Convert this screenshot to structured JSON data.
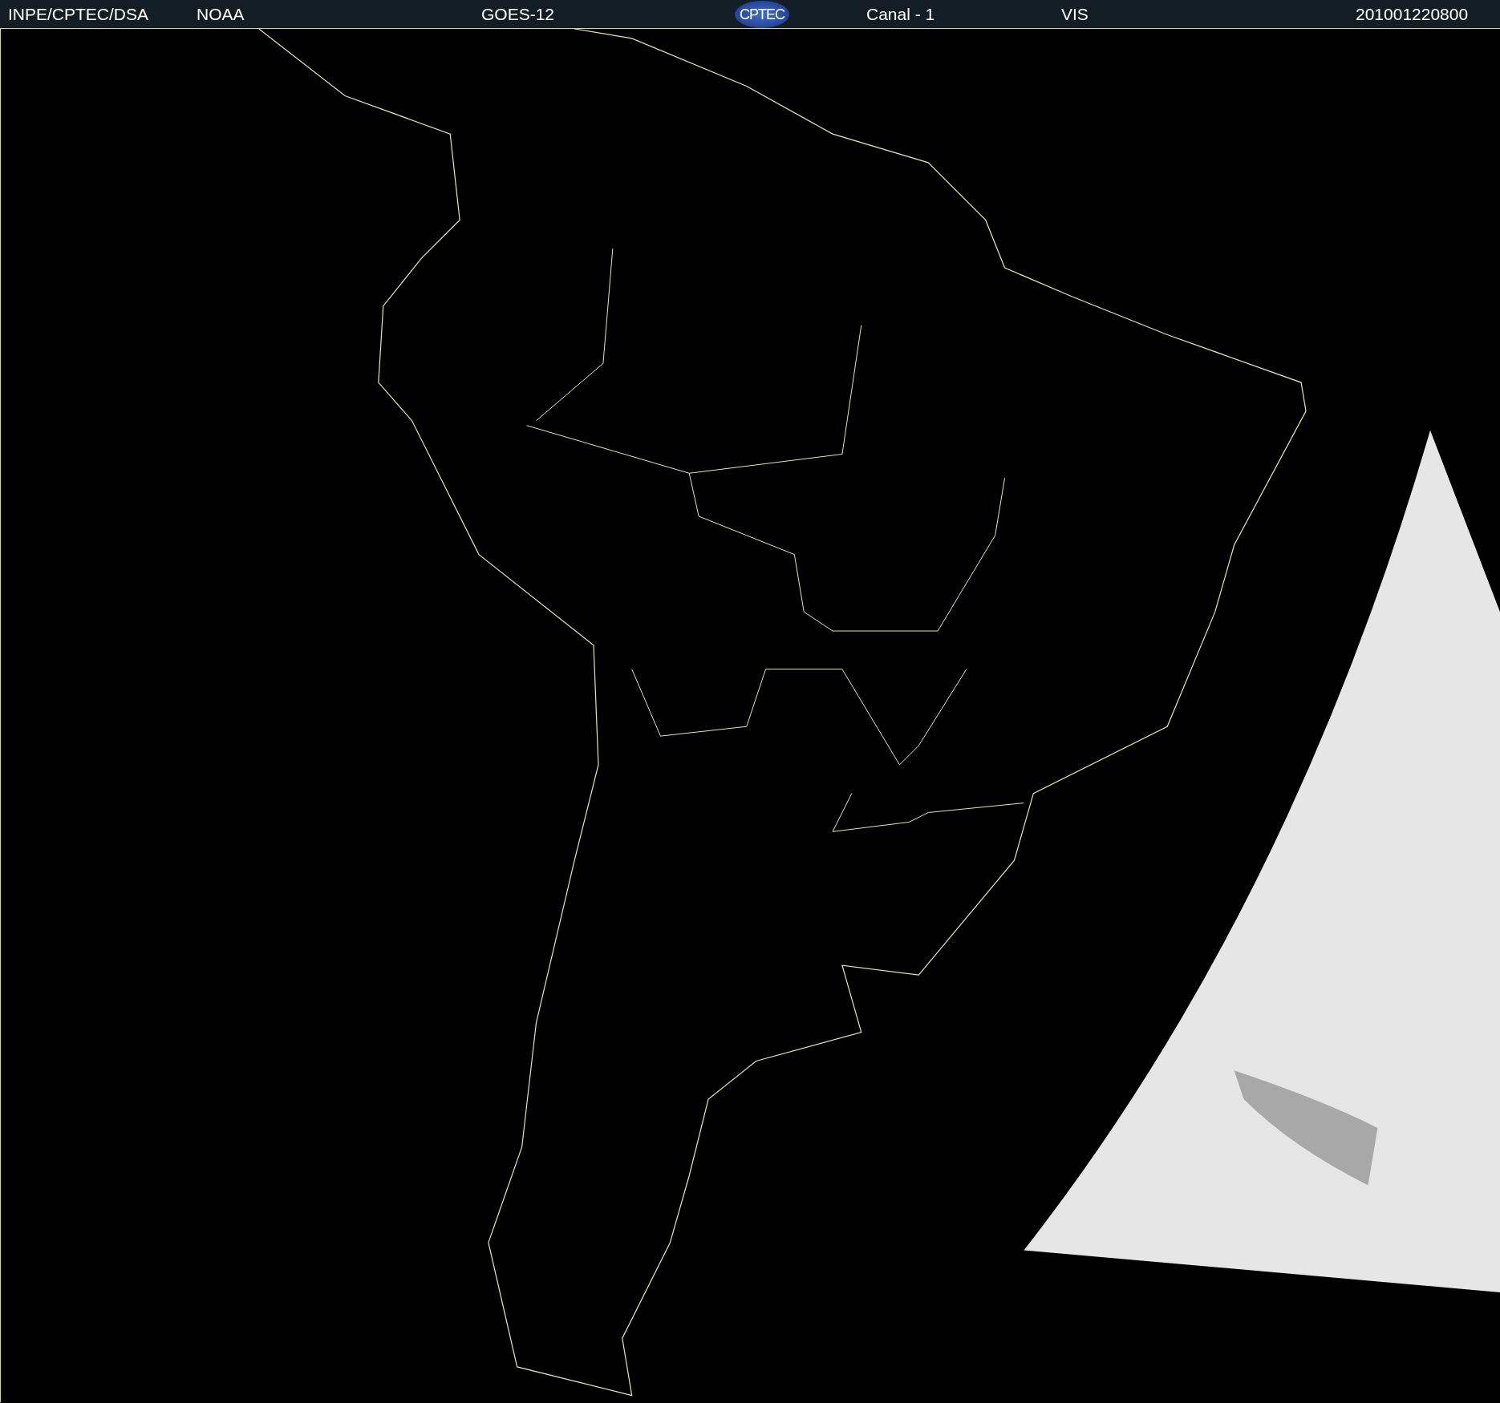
{
  "header": {
    "items": [
      {
        "kind": "text",
        "text": "INPE/CPTEC/DSA"
      },
      {
        "kind": "text",
        "text": "NOAA"
      },
      {
        "kind": "text",
        "text": "GOES-12"
      },
      {
        "kind": "logo",
        "text": "CPTEC"
      },
      {
        "kind": "text",
        "text": "Canal - 1"
      },
      {
        "kind": "text",
        "text": "VIS"
      },
      {
        "kind": "text",
        "text": "201001220800"
      }
    ]
  }
}
